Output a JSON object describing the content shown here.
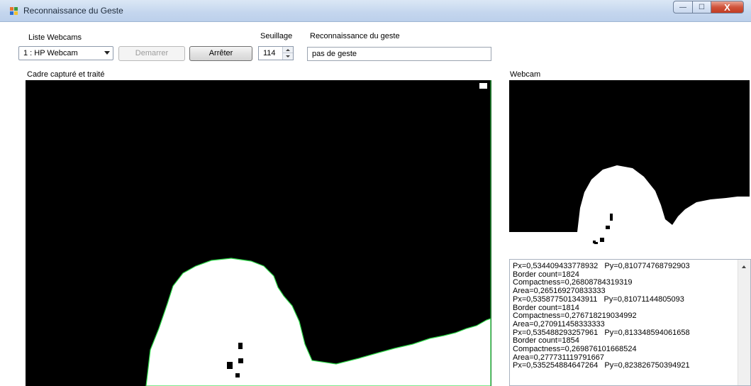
{
  "window": {
    "title": "Reconnaissance du Geste",
    "minimize_glyph": "—",
    "maximize_glyph": "☐",
    "close_glyph": "X",
    "icon": "app-windows-form-icon"
  },
  "controls": {
    "webcam_list_label": "Liste Webcams",
    "webcam_selected": "1 : HP Webcam",
    "start_button": "Demarrer",
    "stop_button": "Arrêter",
    "threshold_label": "Seuillage",
    "threshold_value": "114",
    "gesture_label": "Reconnaissance du geste",
    "gesture_value": "pas de geste"
  },
  "panels": {
    "processed_label": "Cadre capturé et traité",
    "webcam_label": "Webcam"
  },
  "log": {
    "lines": [
      "Px=0,534409433778932   Py=0,810774768792903",
      "Border count=1824",
      "Compactness=0,26808784319319",
      "Area=0,265169270833333",
      "Px=0,535877501343911   Py=0,81071144805093",
      "Border count=1814",
      "Compactness=0,276718219034992",
      "Area=0,270911458333333",
      "Px=0,535488293257961   Py=0,813348594061658",
      "Border count=1854",
      "Compactness=0,269876101668524",
      "Area=0,277731119791667",
      "Px=0,535254884647264   Py=0,823826750394921"
    ]
  },
  "colors": {
    "titlebar": "#c4d6ee",
    "frame_bg": "#000000",
    "blob": "#ffffff",
    "contour": "#2fd94a",
    "close_button": "#c94630"
  }
}
